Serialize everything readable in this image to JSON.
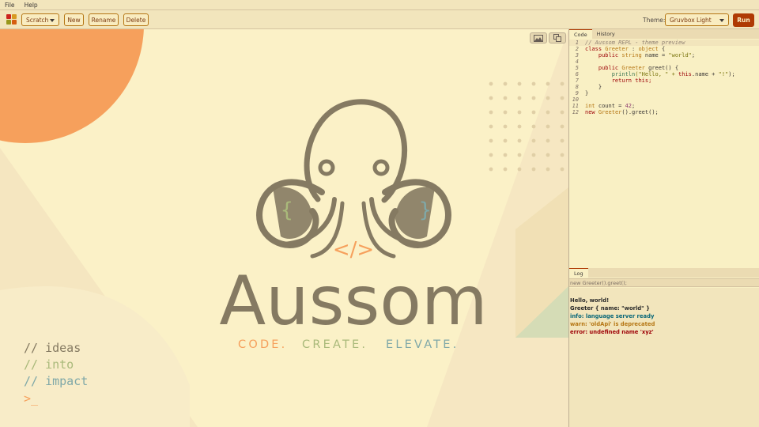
{
  "menu": {
    "file": "File",
    "help": "Help"
  },
  "toolbar": {
    "scratch_select": "Scratch",
    "new_label": "New",
    "rename_label": "Rename",
    "delete_label": "Delete",
    "theme_label": "Theme:",
    "theme_value": "Gruvbox Light",
    "run_label": "Run"
  },
  "canvas": {
    "brand": "Aussom",
    "tagline": {
      "part1": "CODE.",
      "part2": "CREATE.",
      "part3": "ELEVATE."
    },
    "code_glyph": "</>",
    "left_brace": "{",
    "right_brace": "}",
    "comments": [
      "// ideas",
      "// into",
      "// impact"
    ],
    "prompt": ">_",
    "colors": {
      "orange": "#f6a05c",
      "green": "#a9b97a",
      "blue": "#7fa8a8",
      "octopus": "#857a62",
      "background": "#fbf1c7"
    }
  },
  "tabs": {
    "code": "Code",
    "history": "History",
    "log": "Log"
  },
  "editor": {
    "line_numbers": [
      "1",
      "2",
      "3",
      "4",
      "5",
      "6",
      "7",
      "8",
      "9",
      "10",
      "11",
      "12"
    ],
    "comment": "// Aussom REPL - theme preview",
    "kw_class": "class",
    "greeter": "Greeter",
    "colon_object": " : ",
    "object": "object",
    "brace_open": " {",
    "kw_public": "public",
    "kw_string": "string",
    "name_assign": " name = ",
    "world_str": "\"world\"",
    "semicolon": ";",
    "greet_sig": " greet() {",
    "println": "println",
    "hello_str": "(\"Hello, \" + ",
    "this_kw": "this",
    "dot_name": ".name + ",
    "bang_str": "\"!\"",
    "close_paren": ");",
    "kw_return": "return",
    "this_semi": " this;",
    "brace_close": "}",
    "kw_int": "int",
    "count_assign": " count = ",
    "num_42": "42",
    "kw_new": "new",
    "greet_call": "().greet();"
  },
  "log": {
    "input": "new Greeter().greet();",
    "lines": [
      {
        "text": "Hello, world!",
        "color": "#282828"
      },
      {
        "text": "Greeter { name: \"world\" }",
        "color": "#282828"
      },
      {
        "text": "info: language server ready",
        "color": "#076678"
      },
      {
        "text": "warn: 'oldApi' is deprecated",
        "color": "#b57614"
      },
      {
        "text": "error: undefined name 'xyz'",
        "color": "#9d0006"
      }
    ]
  }
}
